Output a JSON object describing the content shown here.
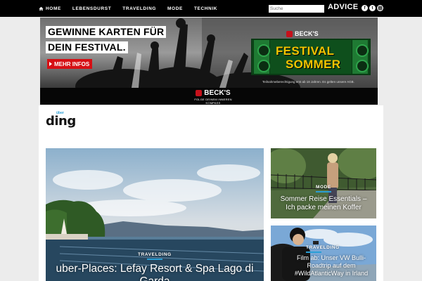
{
  "nav": {
    "items": [
      {
        "label": "HOME",
        "icon": "home-icon"
      },
      {
        "label": "LEBENSDURST"
      },
      {
        "label": "TRAVELDING"
      },
      {
        "label": "MODE"
      },
      {
        "label": "TECHNIK"
      }
    ],
    "search_placeholder": "Suche",
    "brand": "ADVICE",
    "social_icons": [
      "facebook-icon",
      "twitter-icon",
      "instagram-icon"
    ]
  },
  "banner": {
    "headline_line1": "GEWINNE KARTEN FÜR",
    "headline_line2": "DEIN FESTIVAL.",
    "cta_label": "MEHR INFOS",
    "badge_brand": "BECK'S",
    "festival_line1": "FESTIVAL",
    "festival_line2": "SOMMER",
    "disclaimer": "Teilnahmeberechtigung erst ab 18 Jahren. Es gelten unsere AGB.",
    "logo_brand": "BECK'S",
    "logo_tagline": "FOLGE DEINEM INNEREN KOMPASS",
    "colors": {
      "cta": "#d60f14",
      "festival_text": "#f2c300",
      "festival_bg": "#0e4f1c"
    }
  },
  "site": {
    "logo_text": "ding",
    "logo_small": "über",
    "accent": "#2a9fd6"
  },
  "posts": [
    {
      "category": "TRAVELDING",
      "title": "uber-Places: Lefay Resort & Spa Lago di Garda"
    },
    {
      "category": "MODE",
      "title": "Sommer Reise Essentials – Ich packe meinen Koffer"
    },
    {
      "category": "TRAVELDING",
      "title": "Film ab: Unser VW Bulli-Roadtrip auf dem #WildAtlanticWay in Irland"
    }
  ]
}
